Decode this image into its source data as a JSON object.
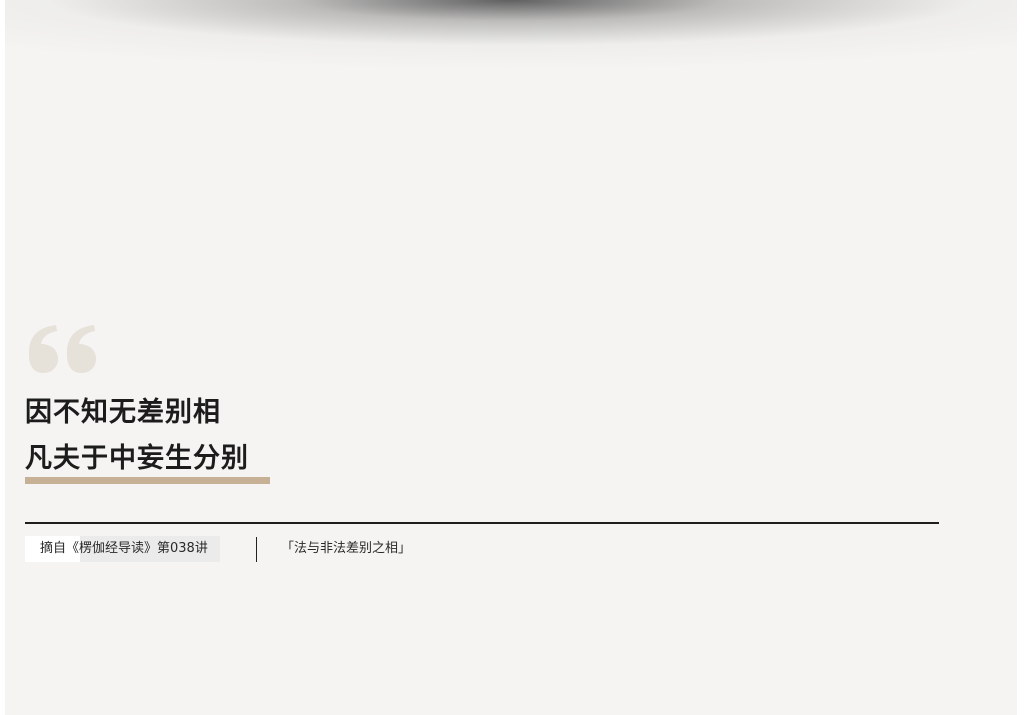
{
  "quote": {
    "line1": "因不知无差别相",
    "line2": "凡夫于中妄生分别"
  },
  "source": {
    "label": "摘自《楞伽经导读》第038讲"
  },
  "topic": {
    "label": "「法与非法差别之相」"
  },
  "icons": {
    "quote_mark": "quote-mark-icon"
  },
  "colors": {
    "background": "#f5f4f2",
    "accent_underline": "#c6b196",
    "quote_mark": "#e6e1d9",
    "text": "#1c1c1c"
  }
}
